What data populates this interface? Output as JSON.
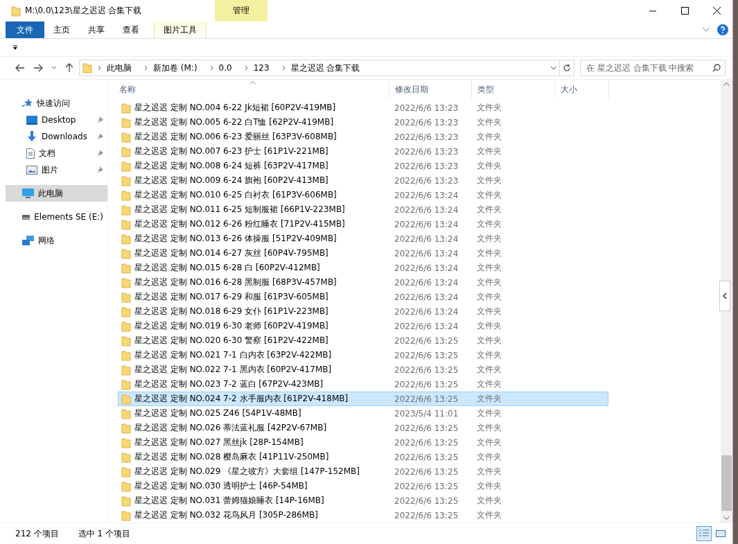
{
  "window": {
    "title": "M:\\0.0\\123\\星之迟迟 合集下载"
  },
  "ribbon": {
    "context_label": "管理",
    "tabs": [
      {
        "label": "文件",
        "kind": "file",
        "selected": false
      },
      {
        "label": "主页",
        "kind": "normal",
        "selected": false
      },
      {
        "label": "共享",
        "kind": "normal",
        "selected": false
      },
      {
        "label": "查看",
        "kind": "normal",
        "selected": false
      },
      {
        "label": "图片工具",
        "kind": "contextual",
        "selected": false
      }
    ]
  },
  "address": {
    "crumbs": [
      "此电脑",
      "新加卷 (M:)",
      "0.0",
      "123",
      "星之迟迟 合集下载"
    ],
    "search_placeholder": "在 星之迟迟 合集下载 中搜索"
  },
  "sidebar": {
    "items": [
      {
        "label": "快速访问",
        "kind": "quick",
        "pinned": false,
        "selected": false
      },
      {
        "label": "Desktop",
        "kind": "desktop",
        "pinned": true,
        "selected": false
      },
      {
        "label": "Downloads",
        "kind": "downloads",
        "pinned": true,
        "selected": false
      },
      {
        "label": "文档",
        "kind": "documents",
        "pinned": true,
        "selected": false
      },
      {
        "label": "图片",
        "kind": "pictures",
        "pinned": true,
        "selected": false
      },
      {
        "label": "此电脑",
        "kind": "pc",
        "pinned": false,
        "selected": true
      },
      {
        "label": "Elements SE (E:)",
        "kind": "drive",
        "pinned": false,
        "selected": false
      },
      {
        "label": "网络",
        "kind": "network",
        "pinned": false,
        "selected": false
      }
    ]
  },
  "table": {
    "columns": [
      "名称",
      "修改日期",
      "类型",
      "大小"
    ],
    "rows": [
      {
        "name": "星之迟迟 定制 NO.004 6-22 Jk短裙 [60P2V-419MB]",
        "date": "2022/6/6 13:23",
        "type": "文件夹",
        "selected": false
      },
      {
        "name": "星之迟迟 定制 NO.005 6-22 白T恤 [62P2V-419MB]",
        "date": "2022/6/6 13:23",
        "type": "文件夹",
        "selected": false
      },
      {
        "name": "星之迟迟 定制 NO.006 6-23 爱丽丝 [63P3V-608MB]",
        "date": "2022/6/6 13:23",
        "type": "文件夹",
        "selected": false
      },
      {
        "name": "星之迟迟 定制 NO.007 6-23 护士 [61P1V-221MB]",
        "date": "2022/6/6 13:23",
        "type": "文件夹",
        "selected": false
      },
      {
        "name": "星之迟迟 定制 NO.008 6-24 短裤 [63P2V-417MB]",
        "date": "2022/6/6 13:23",
        "type": "文件夹",
        "selected": false
      },
      {
        "name": "星之迟迟 定制 NO.009 6-24 旗袍 [60P2V-413MB]",
        "date": "2022/6/6 13:23",
        "type": "文件夹",
        "selected": false
      },
      {
        "name": "星之迟迟 定制 NO.010 6-25 白衬衣 [61P3V-606MB]",
        "date": "2022/6/6 13:24",
        "type": "文件夹",
        "selected": false
      },
      {
        "name": "星之迟迟 定制 NO.011 6-25 短制服裙 [66P1V-223MB]",
        "date": "2022/6/6 13:24",
        "type": "文件夹",
        "selected": false
      },
      {
        "name": "星之迟迟 定制 NO.012 6-26 粉红睡衣 [71P2V-415MB]",
        "date": "2022/6/6 13:24",
        "type": "文件夹",
        "selected": false
      },
      {
        "name": "星之迟迟 定制 NO.013 6-26 体操服 [51P2V-409MB]",
        "date": "2022/6/6 13:24",
        "type": "文件夹",
        "selected": false
      },
      {
        "name": "星之迟迟 定制 NO.014 6-27 灰丝 [60P4V-795MB]",
        "date": "2022/6/6 13:24",
        "type": "文件夹",
        "selected": false
      },
      {
        "name": "星之迟迟 定制 NO.015 6-28 白 [60P2V-412MB]",
        "date": "2022/6/6 13:24",
        "type": "文件夹",
        "selected": false
      },
      {
        "name": "星之迟迟 定制 NO.016 6-28 黑制服 [68P3V-457MB]",
        "date": "2022/6/6 13:24",
        "type": "文件夹",
        "selected": false
      },
      {
        "name": "星之迟迟 定制 NO.017 6-29 和服 [61P3V-605MB]",
        "date": "2022/6/6 13:24",
        "type": "文件夹",
        "selected": false
      },
      {
        "name": "星之迟迟 定制 NO.018 6-29 女仆 [61P1V-223MB]",
        "date": "2022/6/6 13:24",
        "type": "文件夹",
        "selected": false
      },
      {
        "name": "星之迟迟 定制 NO.019 6-30 老师 [60P2V-419MB]",
        "date": "2022/6/6 13:24",
        "type": "文件夹",
        "selected": false
      },
      {
        "name": "星之迟迟 定制 NO.020 6-30 警察 [61P2V-422MB]",
        "date": "2022/6/6 13:25",
        "type": "文件夹",
        "selected": false
      },
      {
        "name": "星之迟迟 定制 NO.021 7-1 白内衣 [63P2V-422MB]",
        "date": "2022/6/6 13:25",
        "type": "文件夹",
        "selected": false
      },
      {
        "name": "星之迟迟 定制 NO.022 7-1 黑内衣 [60P2V-417MB]",
        "date": "2022/6/6 13:25",
        "type": "文件夹",
        "selected": false
      },
      {
        "name": "星之迟迟 定制 NO.023 7-2 蓝白 [67P2V-423MB]",
        "date": "2022/6/6 13:25",
        "type": "文件夹",
        "selected": false
      },
      {
        "name": "星之迟迟 定制 NO.024 7-2 水手服内衣 [61P2V-418MB]",
        "date": "2022/6/6 13:25",
        "type": "文件夹",
        "selected": true
      },
      {
        "name": "星之迟迟 定制 NO.025 Z46 [54P1V-48MB]",
        "date": "2023/5/4 11:01",
        "type": "文件夹",
        "selected": false
      },
      {
        "name": "星之迟迟 定制 NO.026 蒂法蓝礼服 [42P2V-67MB]",
        "date": "2022/6/6 13:25",
        "type": "文件夹",
        "selected": false
      },
      {
        "name": "星之迟迟 定制 NO.027 黑丝jk [28P-154MB]",
        "date": "2022/6/6 13:25",
        "type": "文件夹",
        "selected": false
      },
      {
        "name": "星之迟迟 定制 NO.028 樱岛麻衣 [41P11V-250MB]",
        "date": "2022/6/6 13:25",
        "type": "文件夹",
        "selected": false
      },
      {
        "name": "星之迟迟 定制 NO.029 《星之彼方》大套组 [147P-152MB]",
        "date": "2022/6/6 13:25",
        "type": "文件夹",
        "selected": false
      },
      {
        "name": "星之迟迟 定制 NO.030 透明护士 [46P-54MB]",
        "date": "2022/6/6 13:25",
        "type": "文件夹",
        "selected": false
      },
      {
        "name": "星之迟迟 定制 NO.031 蕾姆猫娘睡衣 [14P-16MB]",
        "date": "2022/6/6 13:25",
        "type": "文件夹",
        "selected": false
      },
      {
        "name": "星之迟迟 定制 NO.032 花鸟风月 [305P-286MB]",
        "date": "2022/6/6 13:25",
        "type": "文件夹",
        "selected": false
      }
    ]
  },
  "status_bar": {
    "count": "212 个项目",
    "selection": "选中 1 个项目"
  }
}
